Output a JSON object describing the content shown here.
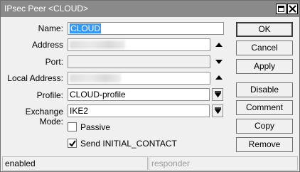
{
  "window": {
    "title": "IPsec Peer <CLOUD>",
    "titlebar_color": "#8a8a8a",
    "controls": [
      "maximize-icon",
      "close-icon"
    ]
  },
  "form": {
    "name": {
      "label": "Name:",
      "value": "CLOUD"
    },
    "address": {
      "label": "Address",
      "value": ""
    },
    "port": {
      "label": "Port:",
      "value": ""
    },
    "local_address": {
      "label": "Local Address:",
      "value": ""
    },
    "profile": {
      "label": "Profile:",
      "value": "CLOUD-profile"
    },
    "exchange_mode": {
      "label": "Exchange Mode:",
      "value": "IKE2"
    },
    "passive": {
      "label": "Passive",
      "checked": false
    },
    "send_initial_contact": {
      "label": "Send INITIAL_CONTACT",
      "checked": true
    }
  },
  "buttons": {
    "ok": "OK",
    "cancel": "Cancel",
    "apply": "Apply",
    "disable": "Disable",
    "comment": "Comment",
    "copy": "Copy",
    "remove": "Remove"
  },
  "status": {
    "left": "enabled",
    "right": "responder"
  },
  "colors": {
    "selection": "#3399ff",
    "window_bg": "#f0f0f0"
  }
}
